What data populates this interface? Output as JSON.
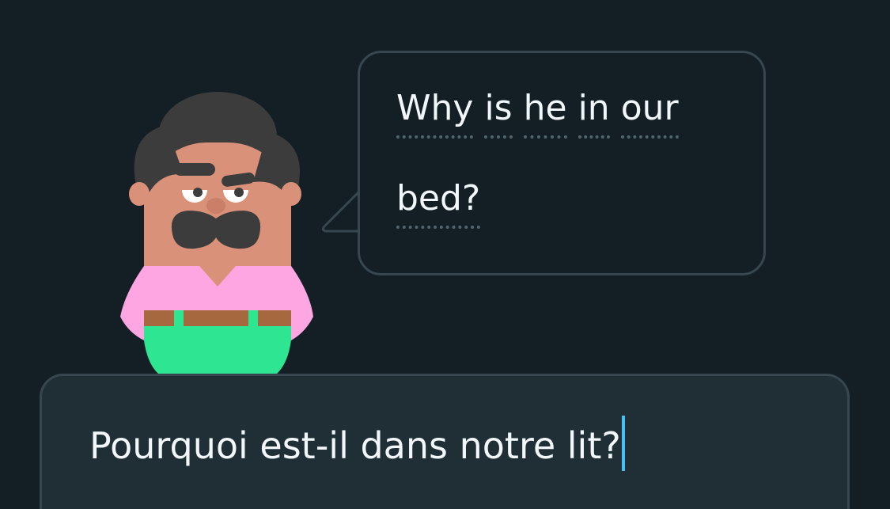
{
  "prompt": {
    "words": [
      "Why",
      "is",
      "he",
      "in",
      "our",
      "bed?"
    ]
  },
  "answer": {
    "value": "Pourquoi est-il dans notre lit?"
  },
  "colors": {
    "background": "#131f24",
    "border": "#37464f",
    "input_bg": "#202f36",
    "text": "#f1f7fb",
    "caret": "#49c0f8",
    "skin": "#d9917a",
    "hair": "#3c3c3c",
    "shirt": "#fea6e1",
    "belt": "#a5683f",
    "pants": "#2ee592"
  },
  "icons": {
    "character": "mustached-man-character",
    "bubble_tail": "speech-bubble-tail"
  }
}
